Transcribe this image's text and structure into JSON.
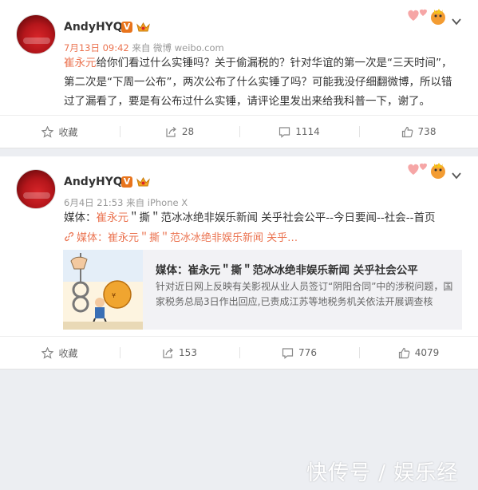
{
  "posts": [
    {
      "username": "AndyHYQ",
      "date": "7月13日 09:42",
      "source": "来自 微博 weibo.com",
      "mention": "崔永元",
      "text_line1": "给你们看过什么实锤吗？关于偷漏税的？针对华谊的第一次是“三天时间”，",
      "text_line2": "第二次是“下周一公布”，两次公布了什么实锤了吗？可能我没仔细翻微博，所以错",
      "text_line3": "过了漏看了，要是有公布过什么实锤，请评论里发出来给我科普一下，谢了。",
      "actions": {
        "favorite": "收藏",
        "repost": "28",
        "comment": "1114",
        "like": "738"
      }
    },
    {
      "username": "AndyHYQ",
      "date": "6月4日 21:53",
      "source": "来自 iPhone X",
      "text_prefix": "媒体：",
      "mention": "崔永元",
      "text_suffix": "＂撕＂范冰冰绝非娱乐新闻 关乎社会公平--今日要闻--社会--首页",
      "link_text": "媒体：崔永元＂撕＂范冰冰绝非娱乐新闻 关乎…",
      "preview_title": "媒体：崔永元＂撕＂范冰冰绝非娱乐新闻 关乎社会公平",
      "preview_desc": "针对近日网上反映有关影视从业人员签订“阴阳合同”中的涉税问题，国家税务总局3日作出回应,已责成江苏等地税务机关依法开展调查核",
      "actions": {
        "favorite": "收藏",
        "repost": "153",
        "comment": "776",
        "like": "4079"
      }
    }
  ],
  "watermark": "快传号 / 娱乐经",
  "colors": {
    "accent": "#eb7350",
    "background": "#eceef2",
    "verified": "#e8741c"
  }
}
